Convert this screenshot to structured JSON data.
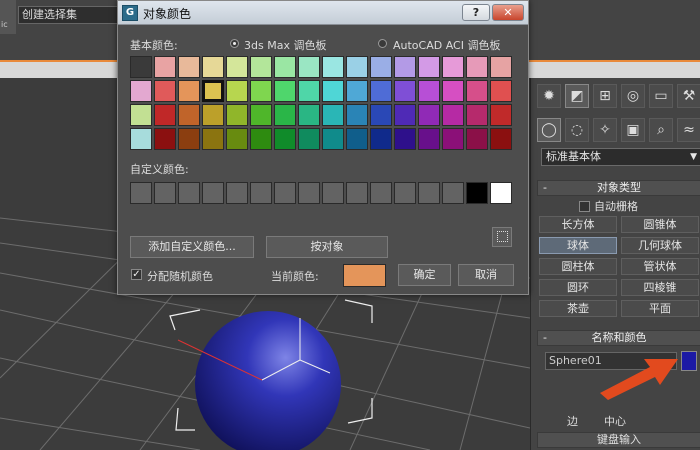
{
  "app": {
    "selection_set_value": "创建选择集",
    "left_mini_label": "ic"
  },
  "dialog": {
    "title": "对象颜色",
    "help_label": "?",
    "close_label": "✕",
    "basic_colors_label": "基本颜色:",
    "palette_options": [
      {
        "label": "3ds Max 调色板",
        "selected": true
      },
      {
        "label": "AutoCAD ACI 调色板",
        "selected": false
      }
    ],
    "basic_colors": [
      "#3a3a3a",
      "#e8a3a3",
      "#e8b99a",
      "#e6d897",
      "#d4e69a",
      "#b3e69a",
      "#9ae6a3",
      "#9ae6c3",
      "#9ae6e2",
      "#9ad0e6",
      "#9aaee6",
      "#b39ae6",
      "#d39ae6",
      "#e69ad8",
      "#e69ab8",
      "#e6a3a3",
      "#e3a8d0",
      "#e05a5a",
      "#e4955a",
      "#dcc251",
      "#b7d64f",
      "#7fd64f",
      "#4fd66c",
      "#4fd6a8",
      "#4fd6d6",
      "#4fa8d6",
      "#4f6cd6",
      "#7f4fd6",
      "#b74fd6",
      "#d64fc2",
      "#d64f8a",
      "#e05050",
      "#c2e093",
      "#c02828",
      "#c0642a",
      "#bca02a",
      "#90b62a",
      "#4fb62a",
      "#2ab648",
      "#2ab684",
      "#2ab6b6",
      "#2a84b6",
      "#2a48b6",
      "#4f2ab6",
      "#902ab6",
      "#b62aa4",
      "#b62a6c",
      "#c02a2a",
      "#a7dcdc",
      "#8b1010",
      "#8b3e10",
      "#8b7410",
      "#688b10",
      "#2e8b10",
      "#108b2a",
      "#108b5e",
      "#108b8b",
      "#105e8b",
      "#102a8b",
      "#2e108b",
      "#68108b",
      "#8b1078",
      "#8b1048",
      "#8b1010"
    ],
    "picked_index": 19,
    "custom_colors_label": "自定义颜色:",
    "custom_colors": [
      "#636363",
      "#636363",
      "#636363",
      "#636363",
      "#636363",
      "#636363",
      "#636363",
      "#636363",
      "#636363",
      "#636363",
      "#636363",
      "#636363",
      "#636363",
      "#636363",
      "#000000",
      "#ffffff"
    ],
    "add_custom_label": "添加自定义颜色...",
    "by_object_label": "按对象",
    "assign_random_label": "分配随机颜色",
    "assign_random_checked": true,
    "current_color_label": "当前颜色:",
    "current_color": "#e4955a",
    "ok_label": "确定",
    "cancel_label": "取消"
  },
  "panel": {
    "dropdown_value": "标准基本体",
    "object_type_header": "对象类型",
    "autogrid_label": "自动栅格",
    "object_buttons": [
      "长方体",
      "圆锥体",
      "球体",
      "几何球体",
      "圆柱体",
      "管状体",
      "圆环",
      "四棱锥",
      "茶壶",
      "平面"
    ],
    "selected_object": "球体",
    "name_color_header": "名称和颜色",
    "name_value": "Sphere01",
    "object_color": "#1c1aa5",
    "bottom_left": "边",
    "bottom_right": "中心",
    "keyboard_header": "键盘输入"
  },
  "colors": {
    "sphere": "#1d1f8c",
    "arrow": "#e24a1e",
    "accent_orange": "#e98a3b"
  }
}
